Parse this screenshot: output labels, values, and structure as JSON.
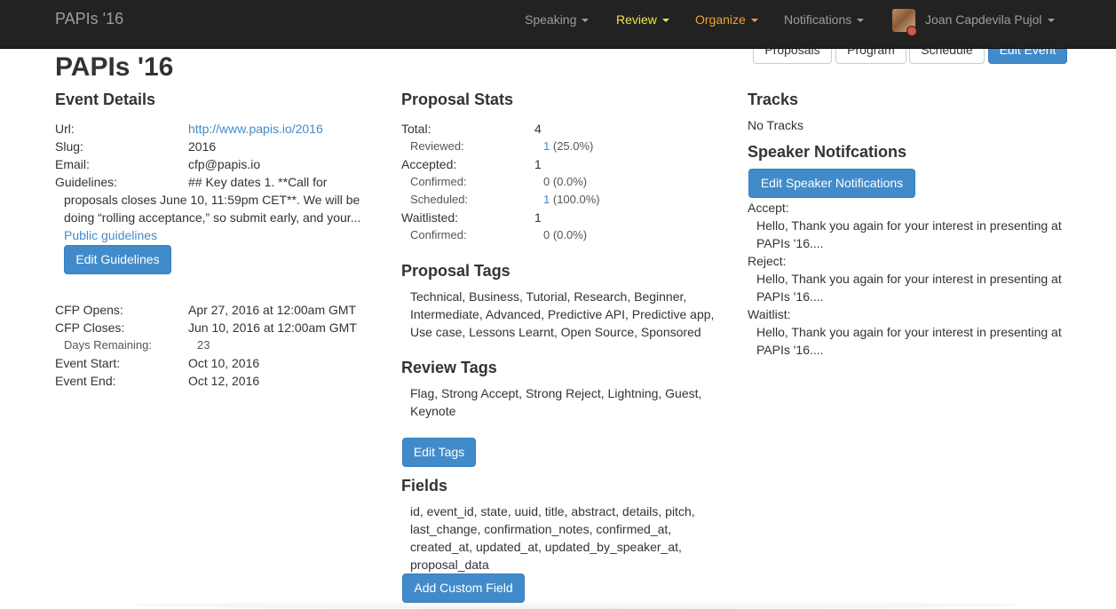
{
  "navbar": {
    "brand": "PAPIs '16",
    "speaking": "Speaking",
    "review": "Review",
    "organize": "Organize",
    "notifications": "Notifications",
    "user": "Joan Capdevila Pujol"
  },
  "top_buttons": {
    "proposals": "Proposals",
    "program": "Program",
    "schedule": "Schedule",
    "edit_event": "Edit Event"
  },
  "page_title": "PAPIs '16",
  "event_details": {
    "title": "Event Details",
    "url_label": "Url:",
    "url_value": "http://www.papis.io/2016",
    "slug_label": "Slug:",
    "slug_value": "2016",
    "email_label": "Email:",
    "email_value": "cfp@papis.io",
    "guidelines_label": "Guidelines:",
    "guidelines_line1": "## Key dates 1. **Call for",
    "guidelines_line2": "proposals closes June 10, 11:59pm CET**. We will be",
    "guidelines_line3": "doing “rolling acceptance,” so submit early, and your...",
    "public_guidelines": "Public guidelines",
    "edit_guidelines": "Edit Guidelines",
    "cfp_opens_label": "CFP Opens:",
    "cfp_opens_value": "Apr 27, 2016 at 12:00am GMT",
    "cfp_closes_label": "CFP Closes:",
    "cfp_closes_value": "Jun 10, 2016 at 12:00am GMT",
    "days_remaining_label": "Days Remaining:",
    "days_remaining_value": "23",
    "event_start_label": "Event Start:",
    "event_start_value": "Oct 10, 2016",
    "event_end_label": "Event End:",
    "event_end_value": "Oct 12, 2016"
  },
  "proposal_stats": {
    "title": "Proposal Stats",
    "total_label": "Total:",
    "total_value": "4",
    "reviewed_label": "Reviewed:",
    "reviewed_count": "1",
    "reviewed_pct": "(25.0%)",
    "accepted_label": "Accepted:",
    "accepted_value": "1",
    "confirmed_label": "Confirmed:",
    "confirmed_value": "0 (0.0%)",
    "scheduled_label": "Scheduled:",
    "scheduled_count": "1",
    "scheduled_pct": "(100.0%)",
    "waitlisted_label": "Waitlisted:",
    "waitlisted_value": "1",
    "waitlist_confirmed_label": "Confirmed:",
    "waitlist_confirmed_value": "0 (0.0%)"
  },
  "proposal_tags": {
    "title": "Proposal Tags",
    "line1": "Technical, Business, Tutorial, Research, Beginner,",
    "line2": "Intermediate, Advanced, Predictive API, Predictive app,",
    "line3": "Use case, Lessons Learnt, Open Source, Sponsored"
  },
  "review_tags": {
    "title": "Review Tags",
    "line1": "Flag, Strong Accept, Strong Reject, Lightning, Guest,",
    "line2": "Keynote"
  },
  "edit_tags": "Edit Tags",
  "fields": {
    "title": "Fields",
    "line1": "id, event_id, state, uuid, title, abstract, details, pitch,",
    "line2": "last_change, confirmation_notes, confirmed_at,",
    "line3": "created_at, updated_at, updated_by_speaker_at,",
    "line4": "proposal_data",
    "add_custom_field": "Add Custom Field"
  },
  "tracks": {
    "title": "Tracks",
    "empty": "No Tracks"
  },
  "speaker_notifications": {
    "title": "Speaker Notifcations",
    "edit_button": "Edit Speaker Notifications",
    "accept_label": "Accept:",
    "accept_line1": "Hello, Thank you again for your interest in presenting at",
    "accept_line2": "PAPIs '16....",
    "reject_label": "Reject:",
    "reject_line1": "Hello, Thank you again for your interest in presenting at",
    "reject_line2": "PAPIs '16....",
    "waitlist_label": "Waitlist:",
    "waitlist_line1": "Hello, Thank you again for your interest in presenting at",
    "waitlist_line2": "PAPIs '16...."
  }
}
